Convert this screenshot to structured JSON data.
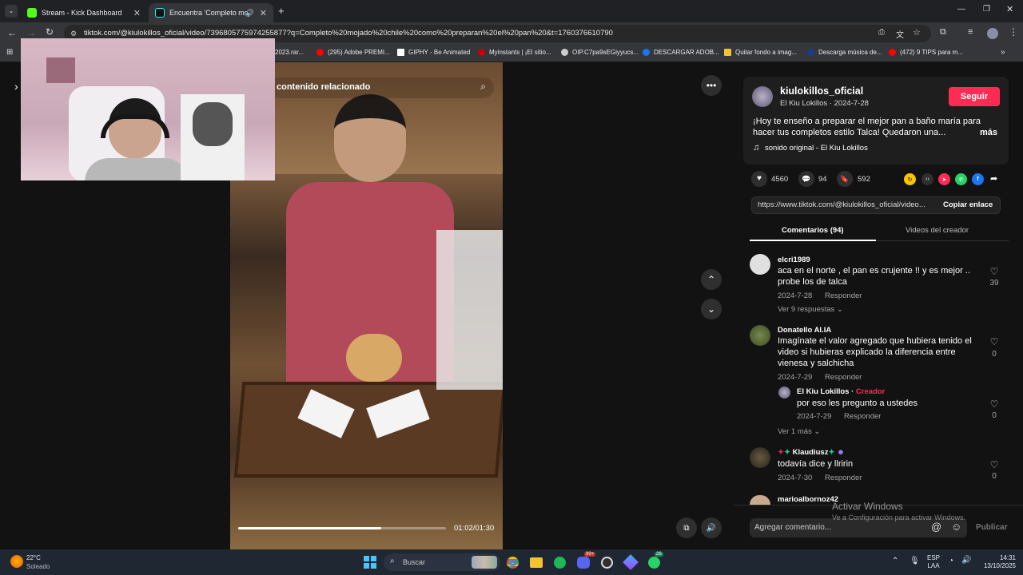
{
  "browser": {
    "tabs": [
      {
        "title": "Stream - Kick Dashboard",
        "icon": "kick-icon"
      },
      {
        "title": "Encuentra 'Completo mojado",
        "icon": "tiktok-icon"
      }
    ],
    "url": "tiktok.com/@kiulokillos_oficial/video/7396805775974255877?q=Completo%20mojado%20chile%20como%20preparan%20el%20pan%20&t=1760376610790",
    "bookmarks": [
      "2023.rar...",
      "(295) Adobe PREMI...",
      "GIPHY - Be Animated",
      "Myinstants | ¡El sitio...",
      "OIP.C7pa9sEGiyyucs...",
      "DESCARGAR ADOB...",
      "Quitar fondo a imag...",
      "Descarga música de...",
      "(472) 9 TIPS para m..."
    ]
  },
  "search": {
    "placeholder": "contenido relacionado"
  },
  "video": {
    "current_time": "01:02",
    "duration": "01:30",
    "time_label": "01:02/01:30",
    "progress": 0.69
  },
  "author": {
    "username": "kiulokillos_oficial",
    "display_name": "El Kiu Lokillos",
    "date": "2024-7-28",
    "subtitle": "El Kiu Lokillos · 2024-7-28",
    "follow_label": "Seguir",
    "description": "¡Hoy te enseño a preparar el mejor pan a baño maría para hacer tus completos estilo Talca! Quedaron una...",
    "more_label": "más",
    "sound": "sonido original - El Kiu Lokillos"
  },
  "stats": {
    "likes": "4560",
    "comments": "94",
    "saves": "592"
  },
  "link": {
    "url": "https://www.tiktok.com/@kiulokillos_oficial/video...",
    "copy_label": "Copiar enlace"
  },
  "tabs": {
    "comments": "Comentarios (94)",
    "creator_videos": "Videos del creador"
  },
  "comments": [
    {
      "user": "elcri1989",
      "text": "aca en el norte , el pan es crujente !! y es mejor .. probe los de talca",
      "date": "2024-7-28",
      "reply_label": "Responder",
      "likes": "39",
      "view_replies": "Ver 9 respuestas"
    },
    {
      "user": "Donatello Al.IA",
      "text": "Imagínate el valor agregado que hubiera tenido el video si hubieras explicado la diferencia entre vienesa y salchicha",
      "date": "2024-7-29",
      "reply_label": "Responder",
      "likes": "0",
      "reply": {
        "user": "El Kiu Lokillos",
        "badge": "Creador",
        "text": "por eso les pregunto a ustedes",
        "date": "2024-7-29",
        "reply_label": "Responder",
        "likes": "0"
      },
      "view_more": "Ver 1 más"
    },
    {
      "user": "Klaudiusz",
      "text": "todavía dice y llririn",
      "date": "2024-7-30",
      "reply_label": "Responder",
      "likes": "0"
    },
    {
      "user": "marioalbornoz42"
    }
  ],
  "comment_input": {
    "placeholder": "Agregar comentario...",
    "post_label": "Publicar"
  },
  "watermark": {
    "line1": "Activar Windows",
    "line2": "Ve a Configuración para activar Windows."
  },
  "taskbar": {
    "weather_temp": "22°C",
    "weather_desc": "Soleado",
    "search_placeholder": "Buscar",
    "lang1": "ESP",
    "lang2": "LAA",
    "time": "14:31",
    "date": "13/10/2025",
    "badge_discord": "99+",
    "badge_whatsapp": "26"
  },
  "colors": {
    "accent": "#fe2c55",
    "creator": "#fe2c55"
  }
}
